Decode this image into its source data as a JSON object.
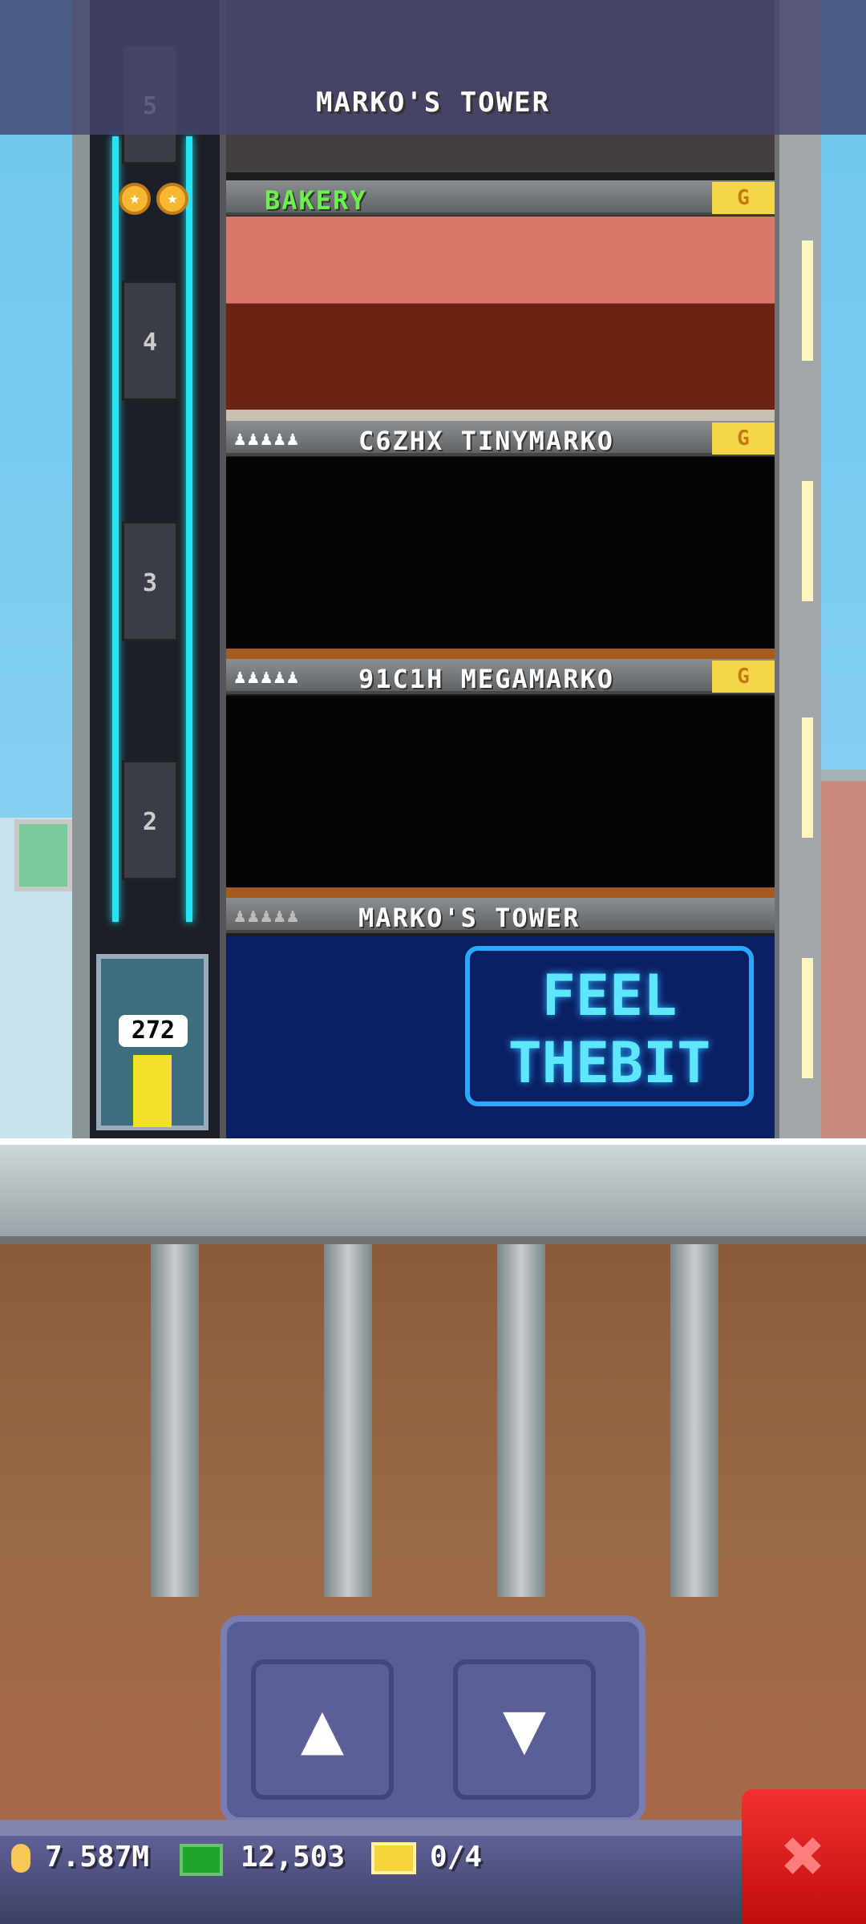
{
  "header": {
    "title": "MARKO'S TOWER"
  },
  "elevator": {
    "floor_numbers": [
      "5",
      "4",
      "3",
      "2"
    ],
    "car_counter": "272",
    "stars": 2
  },
  "floors": [
    {
      "label": "BAKERY",
      "badge": "G",
      "type": "bakery"
    },
    {
      "label": "C6ZHX TINYMARKO",
      "people": "♟♟♟♟♟",
      "badge": "G",
      "type": "apartment"
    },
    {
      "label": "91C1H MEGAMARKO",
      "people": "♟♟♟♟♟",
      "badge": "G",
      "type": "apartment"
    },
    {
      "label": "MARKO'S TOWER",
      "people": "♟♟♟♟♟",
      "type": "lobby",
      "sign": "FEEL THEBIT"
    }
  ],
  "controls": {
    "up_label": "▲",
    "down_label": "▼"
  },
  "status_bar": {
    "coins": "7.587M",
    "bux": "12,503",
    "golden_tickets": "0/4"
  },
  "close_button": {
    "label": "✖"
  },
  "colors": {
    "bakery_label": "#6cf04a",
    "cable": "#26e4f4",
    "close": "#e31e1e",
    "bar": "#55568a"
  }
}
